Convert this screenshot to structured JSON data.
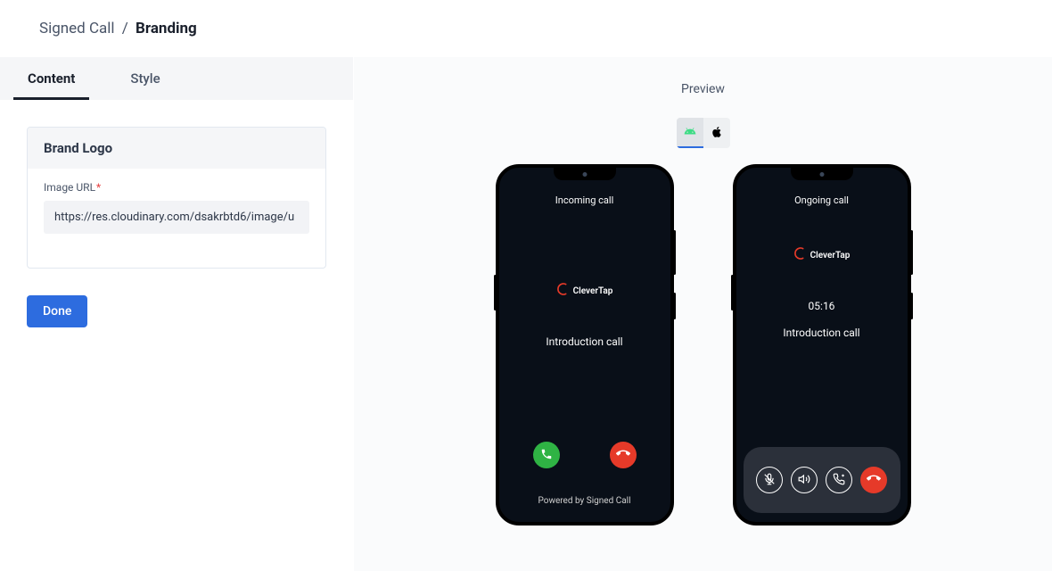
{
  "breadcrumb": {
    "parent": "Signed Call",
    "separator": "/",
    "current": "Branding"
  },
  "tabs": {
    "content": "Content",
    "style": "Style"
  },
  "brand_logo_card": {
    "title": "Brand Logo",
    "field_label": "Image URL",
    "image_url_value": "https://res.cloudinary.com/dsakrbtd6/image/u"
  },
  "done_label": "Done",
  "preview": {
    "title": "Preview"
  },
  "phone_incoming": {
    "status": "Incoming call",
    "brand_text": "CleverTap",
    "call_label": "Introduction call",
    "powered_by": "Powered by Signed Call"
  },
  "phone_ongoing": {
    "status": "Ongoing call",
    "brand_text": "CleverTap",
    "timer": "05:16",
    "call_label": "Introduction call"
  },
  "colors": {
    "primary_btn": "#2d6cdf",
    "accept_btn": "#2fb344",
    "decline_btn": "#e63a29"
  }
}
